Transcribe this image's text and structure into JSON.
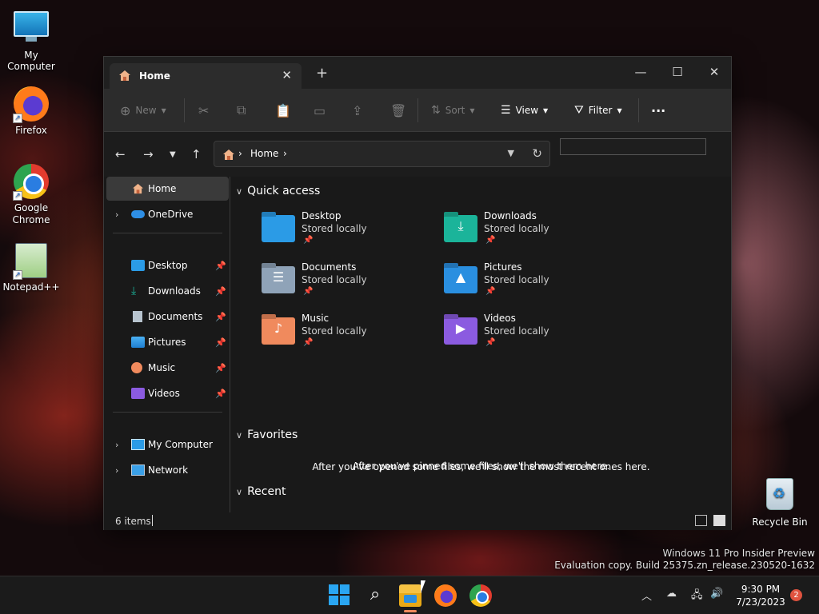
{
  "desktop": {
    "icons": [
      {
        "label": "My Computer"
      },
      {
        "label": "Firefox"
      },
      {
        "label": "Google Chrome"
      },
      {
        "label": "Notepad++"
      },
      {
        "label": "Recycle Bin"
      }
    ],
    "watermark": {
      "line1": "Windows 11 Pro Insider Preview",
      "line2": "Evaluation copy. Build 25375.zn_release.230520-1632"
    }
  },
  "window": {
    "tab_title": "Home",
    "tab_close": "✕",
    "new_tab": "+",
    "controls": {
      "minimize": "—",
      "maximize": "☐",
      "close": "✕"
    },
    "toolbar": {
      "new_label": "New",
      "sort_label": "Sort",
      "view_label": "View",
      "filter_label": "Filter",
      "more": "···"
    },
    "address": {
      "crumb": "Home"
    },
    "search_placeholder": ""
  },
  "sidebar": {
    "items": [
      {
        "label": "Home"
      },
      {
        "label": "OneDrive"
      },
      {
        "label": "Desktop"
      },
      {
        "label": "Downloads"
      },
      {
        "label": "Documents"
      },
      {
        "label": "Pictures"
      },
      {
        "label": "Music"
      },
      {
        "label": "Videos"
      },
      {
        "label": "My Computer"
      },
      {
        "label": "Network"
      }
    ]
  },
  "main": {
    "quick_access_title": "Quick access",
    "folders": [
      {
        "name": "Desktop",
        "status": "Stored locally",
        "color": "#2b9be6"
      },
      {
        "name": "Downloads",
        "status": "Stored locally",
        "color": "#1bb49a"
      },
      {
        "name": "Documents",
        "status": "Stored locally",
        "color": "#8fa3b8"
      },
      {
        "name": "Pictures",
        "status": "Stored locally",
        "color": "#2a8fe0"
      },
      {
        "name": "Music",
        "status": "Stored locally",
        "color": "#f08a5d"
      },
      {
        "name": "Videos",
        "status": "Stored locally",
        "color": "#8b5be0"
      }
    ],
    "favorites_title": "Favorites",
    "favorites_empty": "After you've pinned some files, we'll show them here.",
    "recent_title": "Recent",
    "recent_empty": "After you've opened some files, we'll show the most recent ones here."
  },
  "status": {
    "items_count": "6 items"
  },
  "taskbar": {
    "time": "9:30 PM",
    "date": "7/23/2023",
    "notification_count": "2"
  }
}
